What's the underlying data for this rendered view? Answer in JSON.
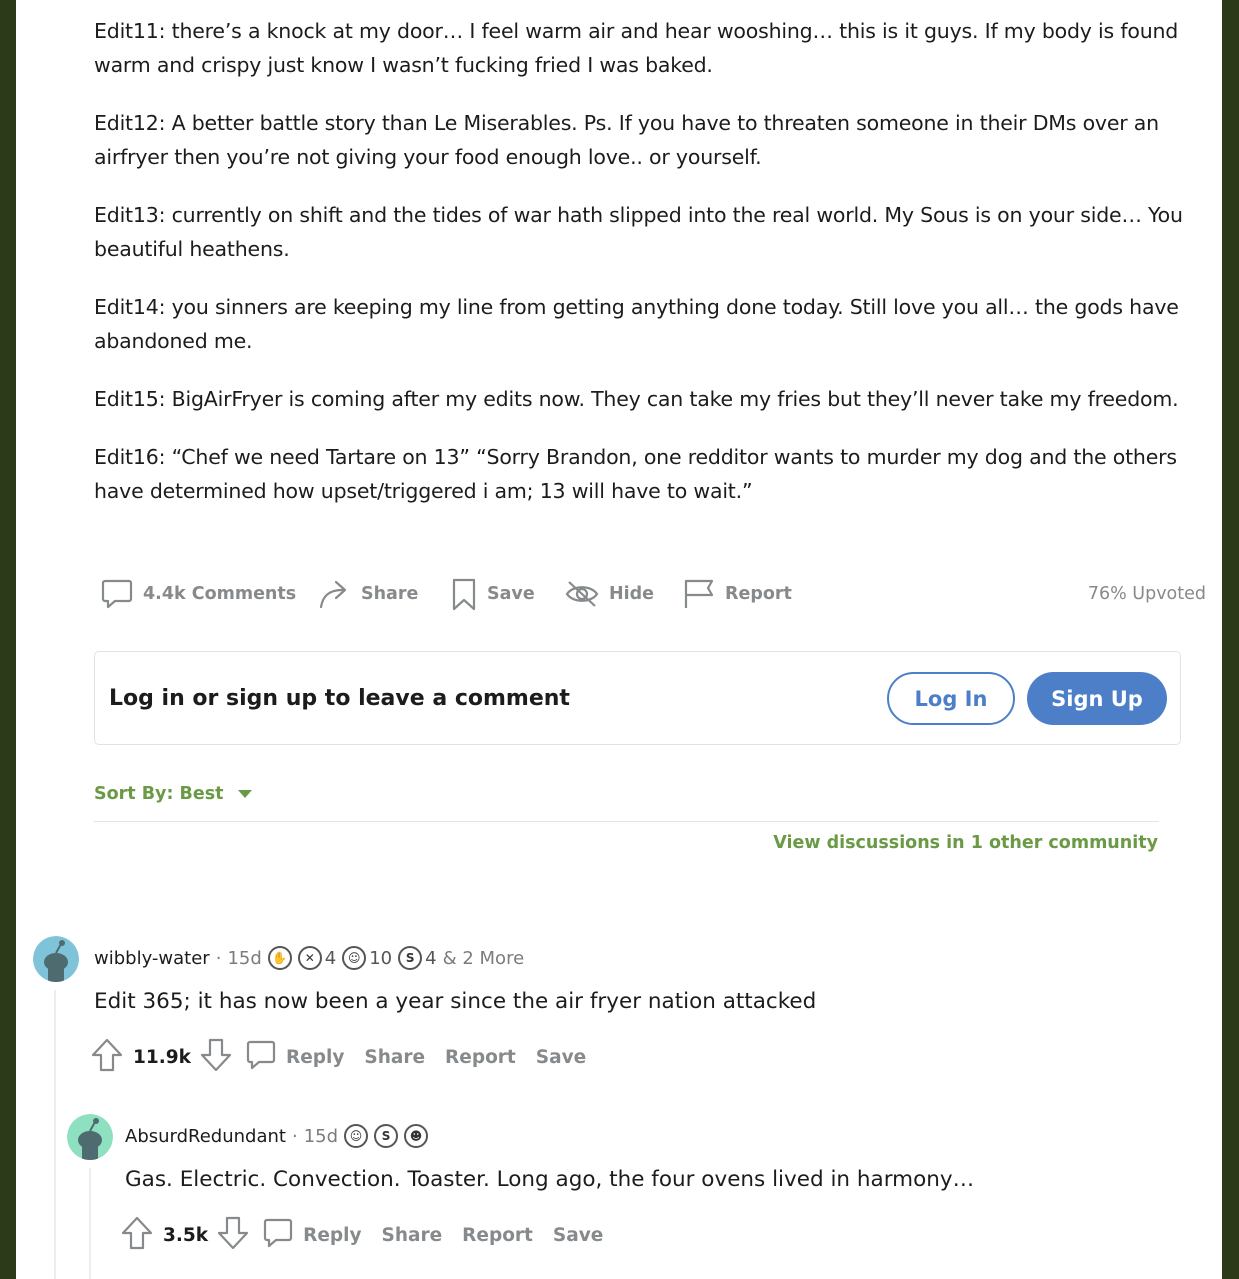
{
  "post": {
    "edits": [
      "Edit11: there’s a knock at my door… I feel warm air and hear wooshing… this is it guys. If my body is found warm and crispy just know I wasn’t fucking fried I was baked.",
      "Edit12: A better battle story than Le Miserables. Ps. If you have to threaten someone in their DMs over an airfryer then you’re not giving your food enough love.. or yourself.",
      "Edit13: currently on shift and the tides of war hath slipped into the real world. My Sous is on your side… You beautiful heathens.",
      "Edit14: you sinners are keeping my line from getting anything done today. Still love you all… the gods have abandoned me.",
      "Edit15: BigAirFryer is coming after my edits now. They can take my fries but they’ll never take my freedom.",
      "Edit16: “Chef we need Tartare on 13” “Sorry Brandon, one redditor wants to murder my dog and the others have determined how upset/triggered i am; 13 will have to wait.”"
    ],
    "actions": {
      "comments": "4.4k Comments",
      "share": "Share",
      "save": "Save",
      "hide": "Hide",
      "report": "Report"
    },
    "upvoted": "76% Upvoted"
  },
  "login_prompt": {
    "text": "Log in or sign up to leave a comment",
    "login": "Log In",
    "signup": "Sign Up"
  },
  "sort": {
    "label": "Sort By: Best"
  },
  "view_discussions": "View discussions in 1 other community",
  "comments": [
    {
      "author": "wibbly-water",
      "age": "15d",
      "awards": [
        {
          "icon": "hands-award-icon",
          "count": ""
        },
        {
          "icon": "crossed-hands-award-icon",
          "count": "4"
        },
        {
          "icon": "laughing-face-award-icon",
          "count": "10"
        },
        {
          "icon": "silver-award-icon",
          "count": "4"
        }
      ],
      "more_awards": "& 2 More",
      "body": "Edit 365; it has now been a year since the air fryer nation attacked",
      "score": "11.9k",
      "reply": "Reply",
      "share": "Share",
      "report": "Report",
      "save": "Save",
      "avatar_color": "#7ec3d8"
    },
    {
      "author": "AbsurdRedundant",
      "age": "15d",
      "awards": [
        {
          "icon": "laughing-face-award-icon",
          "count": ""
        },
        {
          "icon": "silver-award-icon",
          "count": ""
        },
        {
          "icon": "snoo-award-icon",
          "count": ""
        }
      ],
      "body": "Gas. Electric. Convection. Toaster. Long ago, the four ovens lived in harmony…",
      "score": "3.5k",
      "reply": "Reply",
      "share": "Share",
      "report": "Report",
      "save": "Save",
      "avatar_color": "#8fe0c0"
    }
  ]
}
